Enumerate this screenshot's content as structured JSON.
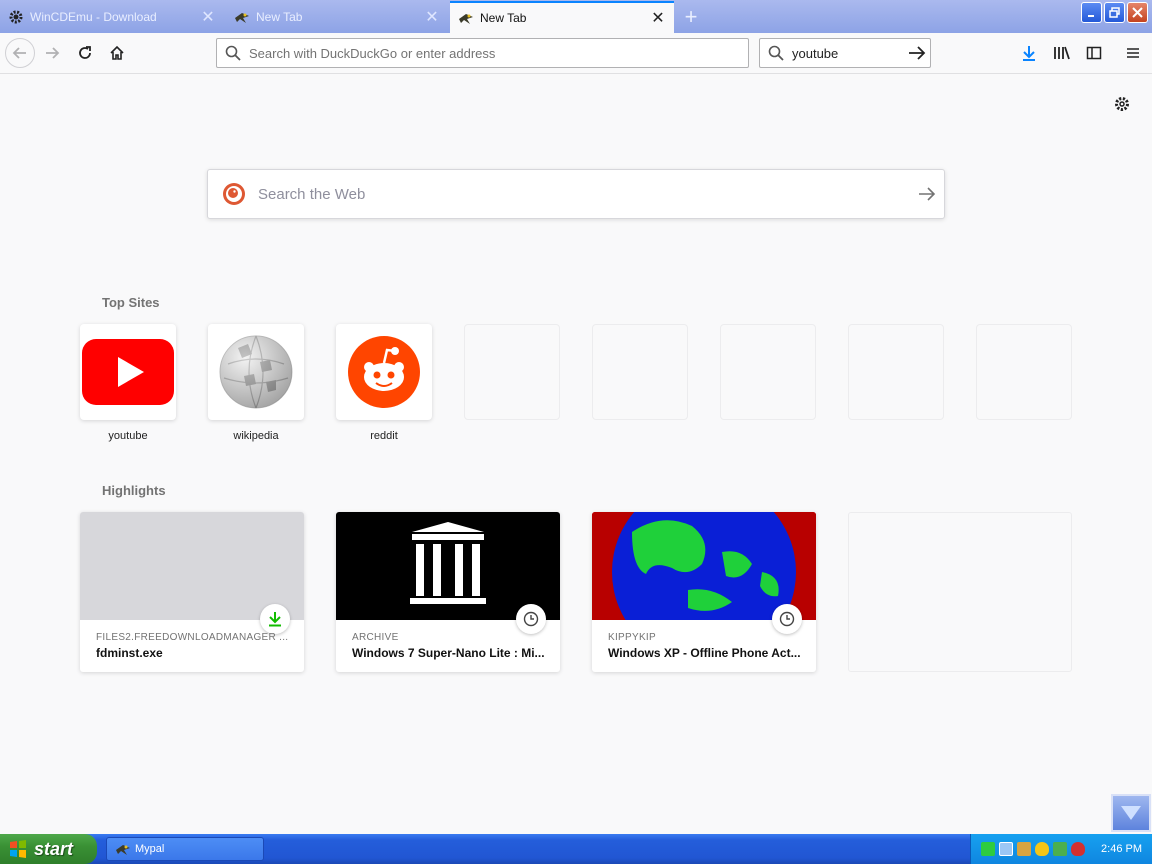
{
  "tabs": [
    {
      "title": "WinCDEmu - Download",
      "active": false,
      "icon": "gear-icon"
    },
    {
      "title": "New Tab",
      "active": false,
      "icon": "mypal-icon"
    },
    {
      "title": "New Tab",
      "active": true,
      "icon": "mypal-icon"
    }
  ],
  "navbar": {
    "url_placeholder": "Search with DuckDuckGo or enter address",
    "search_value": "youtube"
  },
  "newtab": {
    "search_placeholder": "Search the Web",
    "top_sites_label": "Top Sites",
    "highlights_label": "Highlights",
    "top_sites": [
      {
        "label": "youtube"
      },
      {
        "label": "wikipedia"
      },
      {
        "label": "reddit"
      }
    ],
    "highlights": [
      {
        "host": "FILES2.FREEDOWNLOADMANAGER ...",
        "title": "fdminst.exe",
        "badge": "download-icon"
      },
      {
        "host": "ARCHIVE",
        "title": "Windows 7 Super-Nano Lite : Mi...",
        "badge": "clock-icon"
      },
      {
        "host": "KIPPYKIP",
        "title": "Windows XP - Offline Phone Act...",
        "badge": "clock-icon"
      }
    ]
  },
  "taskbar": {
    "start_label": "start",
    "task_label": "Mypal",
    "clock": "2:46 PM"
  },
  "colors": {
    "accent": "#0a84ff",
    "youtube_red": "#ff0000",
    "reddit_orange": "#ff4500",
    "download_green": "#12bc00"
  }
}
